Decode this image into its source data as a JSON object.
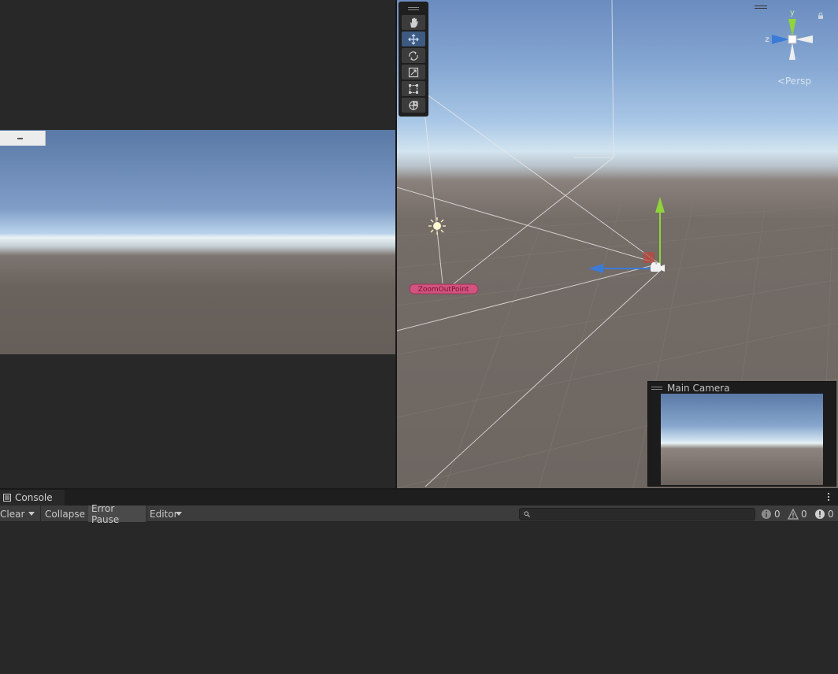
{
  "scene": {
    "gizmo_axes": {
      "y": "y",
      "z": "z"
    },
    "projection_label": "Persp",
    "object_label": "ZoomOutPoint",
    "tools": [
      {
        "name": "hand-tool",
        "icon": "hand-icon"
      },
      {
        "name": "move-tool",
        "icon": "move-icon",
        "active": true
      },
      {
        "name": "rotate-tool",
        "icon": "rotate-icon"
      },
      {
        "name": "scale-tool",
        "icon": "scale-icon"
      },
      {
        "name": "rect-tool",
        "icon": "rect-icon"
      },
      {
        "name": "transform-tool",
        "icon": "transform-icon"
      }
    ]
  },
  "camera_preview": {
    "title": "Main Camera"
  },
  "console": {
    "tab_label": "Console",
    "clear_label": "Clear",
    "collapse_label": "Collapse",
    "error_pause_label": "Error Pause",
    "editor_label": "Editor",
    "search_placeholder": "",
    "log_count": "0",
    "warning_count": "0",
    "error_count": "0"
  },
  "colors": {
    "y_axis": "#8fd43a",
    "z_axis": "#3b7bd8",
    "label_pill": "#d0547f",
    "editor_bg": "#282828"
  }
}
